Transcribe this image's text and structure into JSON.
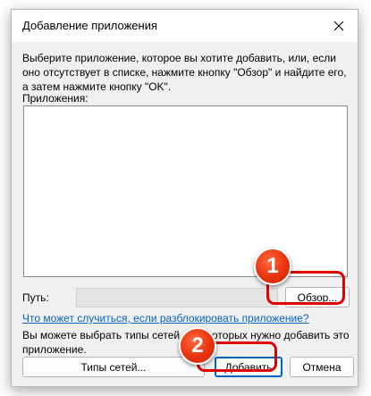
{
  "dialog": {
    "title": "Добавление приложения",
    "instructions": "Выберите приложение, которое вы хотите добавить, или, если оно отсутствует в списке, нажмите кнопку \"Обзор\" и найдите его, а затем нажмите кнопку \"OK\".",
    "apps_label": "Приложения:",
    "path_label": "Путь:",
    "path_value": "",
    "browse_label": "Обзор...",
    "link_text": "Что может случиться, если разблокировать приложение?",
    "network_info": "Вы можете выбрать типы сетей, для которых нужно добавить это приложение.",
    "network_types_label": "Типы сетей...",
    "add_label": "Добавить",
    "cancel_label": "Отмена"
  },
  "annotations": {
    "badge1": "1",
    "badge2": "2",
    "highlight_color": "#e10000"
  },
  "colors": {
    "link": "#0563c1",
    "default_button_border": "#0067c0",
    "badge": "#e8330e"
  }
}
